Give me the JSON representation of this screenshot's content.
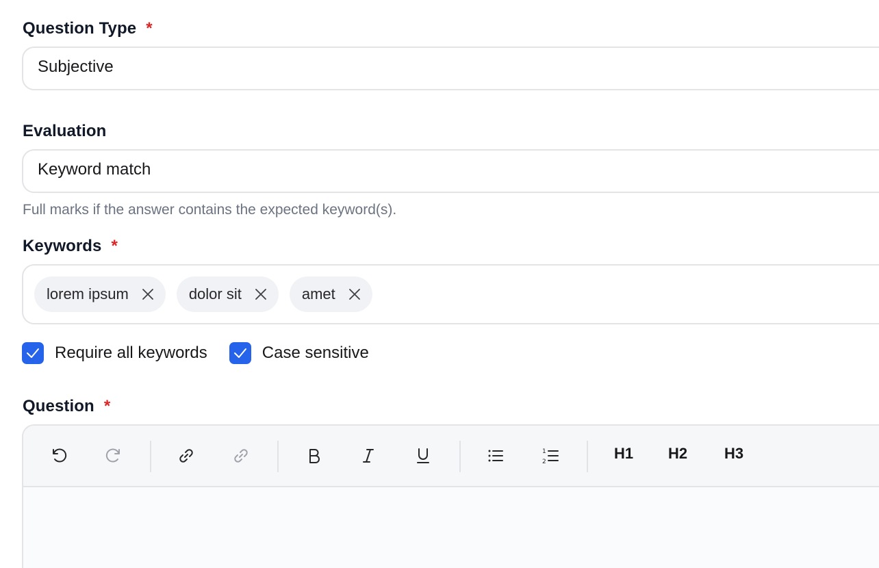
{
  "question_type": {
    "label": "Question Type",
    "required_mark": "*",
    "value": "Subjective"
  },
  "evaluation": {
    "label": "Evaluation",
    "value": "Keyword match",
    "help": "Full marks if the answer contains the expected keyword(s)."
  },
  "keywords": {
    "label": "Keywords",
    "required_mark": "*",
    "chips": [
      {
        "text": "lorem ipsum",
        "remove_icon": "close-icon"
      },
      {
        "text": "dolor sit",
        "remove_icon": "close-icon"
      },
      {
        "text": "amet",
        "remove_icon": "close-icon"
      }
    ]
  },
  "options": {
    "require_all": {
      "label": "Require all keywords",
      "checked": true
    },
    "case_sensitive": {
      "label": "Case sensitive",
      "checked": true
    }
  },
  "question": {
    "label": "Question",
    "required_mark": "*",
    "toolbar": {
      "icons": [
        "undo-icon",
        "redo-icon",
        "link-icon",
        "unlink-icon",
        "bold-icon",
        "italic-icon",
        "underline-icon",
        "bullet-list-icon",
        "numbered-list-icon"
      ],
      "h1": "H1",
      "h2": "H2",
      "h3": "H3"
    }
  },
  "colors": {
    "accent": "#2563eb",
    "required": "#dc2626",
    "border": "#e4e4e7",
    "chip_bg": "#f1f2f5"
  }
}
